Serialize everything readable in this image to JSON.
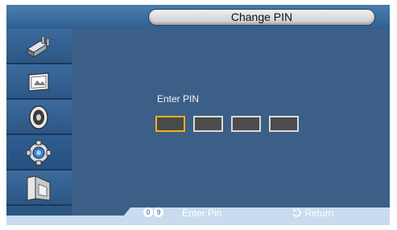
{
  "title": "Change PIN",
  "sidebar": {
    "items": [
      {
        "icon": "input-plug-icon"
      },
      {
        "icon": "picture-icon"
      },
      {
        "icon": "sound-icon"
      },
      {
        "icon": "setup-gear-icon",
        "selected": true
      },
      {
        "icon": "multi-window-icon"
      }
    ]
  },
  "pin": {
    "label": "Enter PIN",
    "digit_count": 4,
    "active_index": 0
  },
  "hints": {
    "key_start": "0",
    "key_end": "9",
    "enter_pin": "Enter Pin",
    "return": "Return"
  },
  "colors": {
    "panel": "#3b5f87",
    "sidebar": "#2c5685",
    "active_border": "#f0b020",
    "hint_bar": "#c9dcef"
  }
}
